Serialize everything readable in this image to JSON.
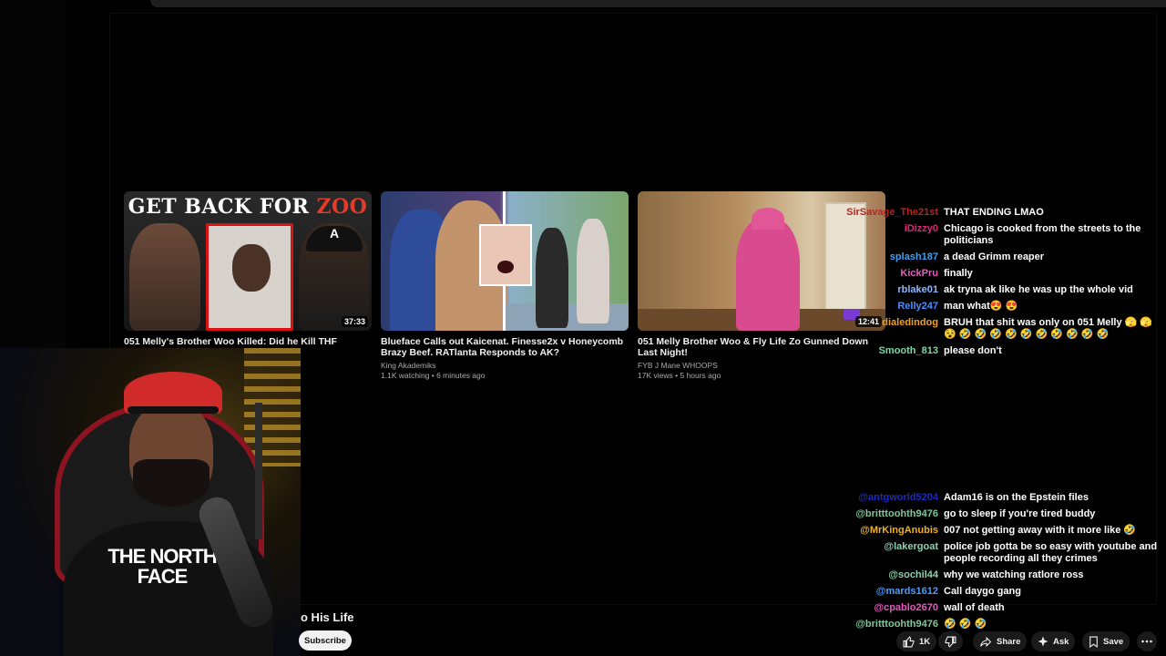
{
  "end_cards": [
    {
      "title": "051 Melly's Brother Woo Killed: Did he Kill THF Bayzoo?",
      "channel": "",
      "stats": "",
      "duration": "37:33",
      "thumb_text_white": "GET BACK FOR ",
      "thumb_text_red": "ZOO",
      "cap_letter": "A"
    },
    {
      "title": "Blueface Calls out Kaicenat. Finesse2x v Honeycomb Brazy Beef. RATlanta Responds to AK?",
      "channel": "King Akademiks",
      "stats": "1.1K watching • 6 minutes ago",
      "duration": ""
    },
    {
      "title": "051 Melly Brother Woo & Fly Life Zo Gunned Down Last Night!",
      "channel": "FYB J Mane WHOOPS",
      "stats": "17K views • 5 hours ago",
      "duration": "12:41"
    }
  ],
  "webcam": {
    "shirt_logo": "THE NORTH FACE"
  },
  "video": {
    "title_fragment": "o His Life",
    "subscribe_label": "Subscribe"
  },
  "actions": {
    "likes": "1K",
    "share_label": "Share",
    "ask_label": "Ask",
    "save_label": "Save"
  },
  "chat_top": [
    {
      "user": "SirSavage_The21st",
      "msg": "THAT ENDING LMAO",
      "color": "#b3261e"
    },
    {
      "user": "iDizzy0",
      "msg": "Chicago is cooked from the streets to the politicians",
      "color": "#e0247a"
    },
    {
      "user": "splash187",
      "msg": "a dead Grimm reaper",
      "color": "#3fa0f0"
    },
    {
      "user": "KickPru",
      "msg": "finally",
      "color": "#e25bbf"
    },
    {
      "user": "rblake01",
      "msg": "ak tryna ak like he was up the whole vid",
      "color": "#8fb7ff"
    },
    {
      "user": "Relly247",
      "msg": "man what😍 😍",
      "color": "#4c8dff"
    },
    {
      "user": "dialedindog",
      "msg": "BRUH that shit was only on 051 Melly 🫣 🫣 😵 🤣 🤣 🤣 🤣 🤣 🤣 🤣 🤣 🤣 🤣",
      "color": "#f0a020"
    },
    {
      "user": "Smooth_813",
      "msg": "please don't",
      "color": "#7fd6a6"
    }
  ],
  "chat_bottom": [
    {
      "user": "@antgworld5204",
      "msg": "Adam16 is on the Epstein files",
      "color": "#1c2ab8"
    },
    {
      "user": "@britttoohth9476",
      "msg": "go to sleep if you're tired buddy",
      "color": "#7fc79a"
    },
    {
      "user": "@MrKingAnubis",
      "msg": "007 not getting away with it more like 🤣",
      "color": "#f0b020"
    },
    {
      "user": "@lakergoat",
      "msg": "police job gotta be so easy with youtube and people recording all they crimes",
      "color": "#8fd0b0"
    },
    {
      "user": "@sochil44",
      "msg": "why we watching ratlore ross",
      "color": "#8fd0b0"
    },
    {
      "user": "@mards1612",
      "msg": "Call daygo gang",
      "color": "#4c9dff"
    },
    {
      "user": "@cpablo2670",
      "msg": "wall of death",
      "color": "#e25bbf"
    },
    {
      "user": "@britttoohth9476",
      "msg": "🤣 🤣 🤣",
      "color": "#7fc79a"
    }
  ]
}
